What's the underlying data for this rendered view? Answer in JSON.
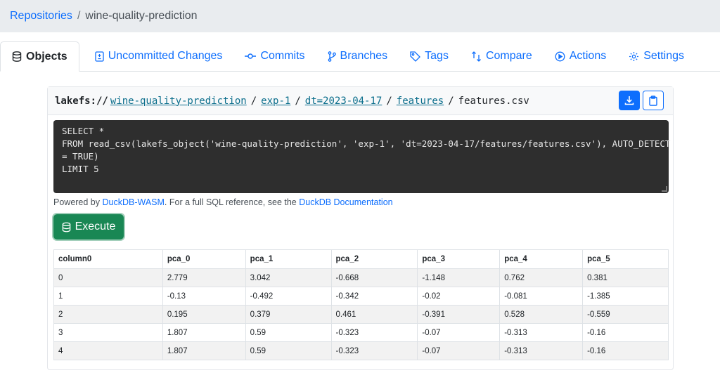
{
  "breadcrumb": {
    "root": "Repositories",
    "separator": "/",
    "repo": "wine-quality-prediction"
  },
  "tabs": [
    {
      "label": "Objects",
      "icon": "database-icon",
      "active": true
    },
    {
      "label": "Uncommitted Changes",
      "icon": "file-diff-icon"
    },
    {
      "label": "Commits",
      "icon": "commit-icon"
    },
    {
      "label": "Branches",
      "icon": "branch-icon"
    },
    {
      "label": "Tags",
      "icon": "tag-icon"
    },
    {
      "label": "Compare",
      "icon": "compare-icon"
    },
    {
      "label": "Actions",
      "icon": "play-circle-icon"
    },
    {
      "label": "Settings",
      "icon": "gear-icon"
    }
  ],
  "path": {
    "scheme": "lakefs://",
    "segments": [
      "wine-quality-prediction",
      "exp-1",
      "dt=2023-04-17",
      "features"
    ],
    "separator": "/",
    "file": "features.csv"
  },
  "editor": {
    "lines": [
      "SELECT *",
      "FROM read_csv(lakefs_object('wine-quality-prediction', 'exp-1', 'dt=2023-04-17/features/features.csv'), AUTO_DETECT",
      "= TRUE)",
      "LIMIT 5"
    ]
  },
  "powered": {
    "prefix": "Powered by ",
    "duckdb_link": "DuckDB-WASM",
    "middle": ". For a full SQL reference, see the ",
    "docs_link": "DuckDB Documentation"
  },
  "execute_label": "Execute",
  "results": {
    "columns": [
      "column0",
      "pca_0",
      "pca_1",
      "pca_2",
      "pca_3",
      "pca_4",
      "pca_5"
    ],
    "rows": [
      [
        "0",
        "2.779",
        "3.042",
        "-0.668",
        "-1.148",
        "0.762",
        "0.381"
      ],
      [
        "1",
        "-0.13",
        "-0.492",
        "-0.342",
        "-0.02",
        "-0.081",
        "-1.385"
      ],
      [
        "2",
        "0.195",
        "0.379",
        "0.461",
        "-0.391",
        "0.528",
        "-0.559"
      ],
      [
        "3",
        "1.807",
        "0.59",
        "-0.323",
        "-0.07",
        "-0.313",
        "-0.16"
      ],
      [
        "4",
        "1.807",
        "0.59",
        "-0.323",
        "-0.07",
        "-0.313",
        "-0.16"
      ]
    ]
  },
  "colors": {
    "link": "#0d6efd",
    "success": "#198754",
    "editor_bg": "#2e2e2e"
  }
}
